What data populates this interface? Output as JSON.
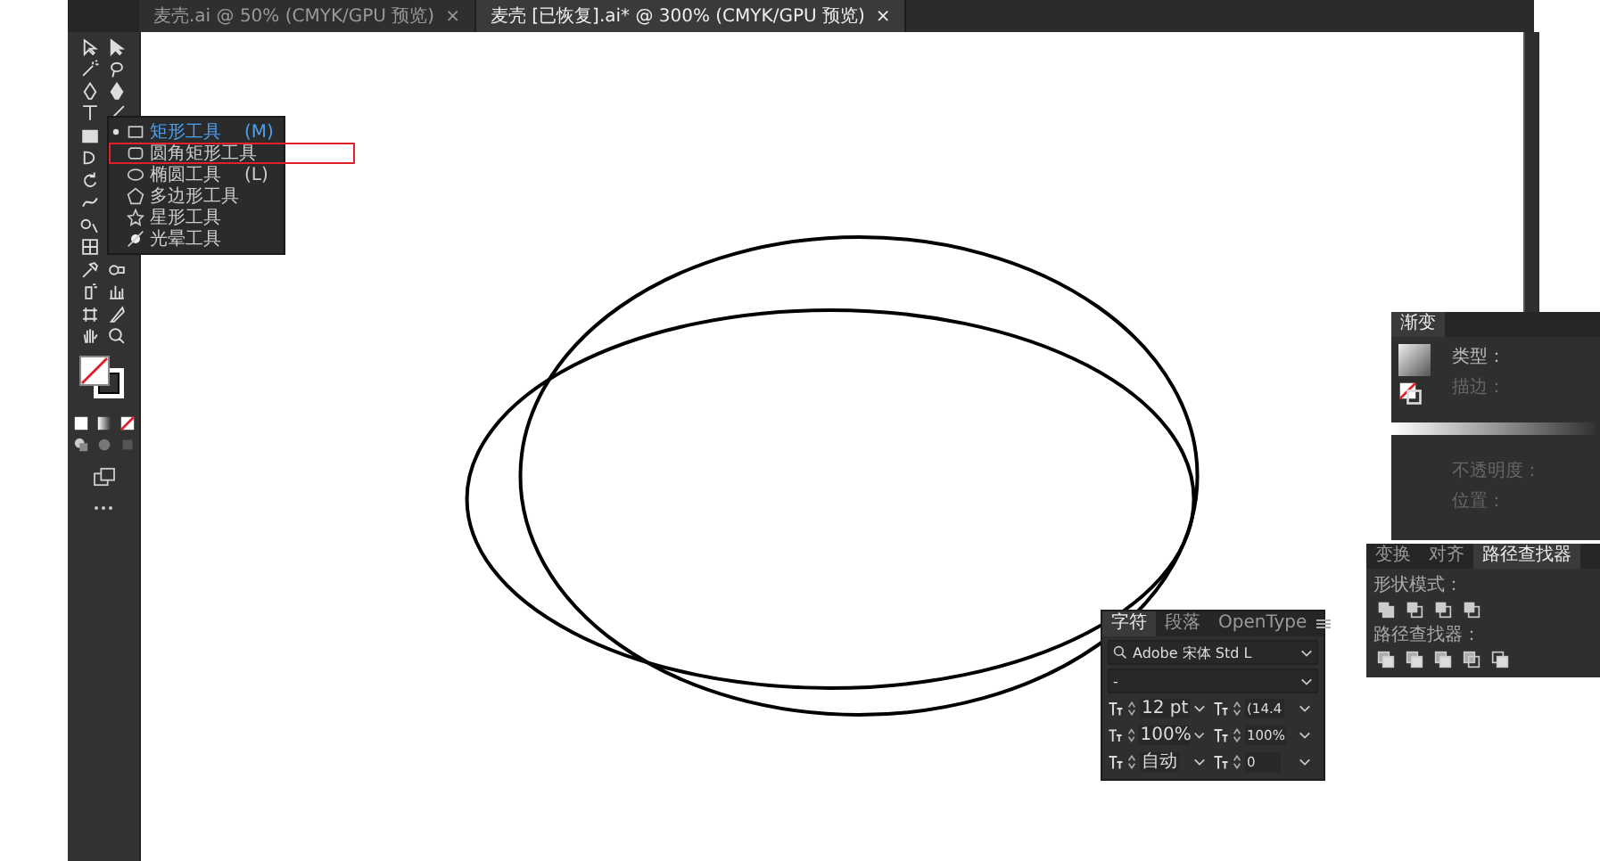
{
  "document_tabs": [
    {
      "label": "麦壳.ai @ 50% (CMYK/GPU 预览)",
      "selected": false,
      "close": "×"
    },
    {
      "label": "麦壳 [已恢复].ai* @ 300% (CMYK/GPU 预览)",
      "selected": true,
      "close": "×"
    }
  ],
  "tool_flyout": {
    "items": [
      {
        "label": "矩形工具",
        "shortcut": "(M)",
        "selected": true,
        "highlighted": false
      },
      {
        "label": "圆角矩形工具",
        "selected": false,
        "highlighted": true
      },
      {
        "label": "椭圆工具",
        "shortcut": "(L)",
        "selected": false,
        "highlighted": false
      },
      {
        "label": "多边形工具",
        "selected": false,
        "highlighted": false
      },
      {
        "label": "星形工具",
        "selected": false,
        "highlighted": false
      },
      {
        "label": "光晕工具",
        "selected": false,
        "highlighted": false
      }
    ]
  },
  "gradient_panel": {
    "tab": "渐变",
    "fields": [
      {
        "label": "类型：",
        "disabled": false
      },
      {
        "label": "描边：",
        "disabled": true
      },
      {
        "label": "不透明度：",
        "disabled": true
      },
      {
        "label": "位置：",
        "disabled": true
      }
    ]
  },
  "pathfinder_panel": {
    "tabs": [
      {
        "label": "变换",
        "selected": false
      },
      {
        "label": "对齐",
        "selected": false
      },
      {
        "label": "路径查找器",
        "selected": true
      }
    ],
    "shape_modes_label": "形状模式：",
    "pathfinders_label": "路径查找器："
  },
  "character_panel": {
    "tabs": [
      {
        "label": "字符",
        "selected": true
      },
      {
        "label": "段落",
        "selected": false
      },
      {
        "label": "OpenType",
        "selected": false
      }
    ],
    "font_family": "Adobe 宋体 Std L",
    "font_style": "-",
    "font_size": "12 pt",
    "leading": "(14.4",
    "vertical_scale": "100%",
    "horizontal_scale": "100%",
    "kerning": "自动",
    "tracking": "0"
  }
}
